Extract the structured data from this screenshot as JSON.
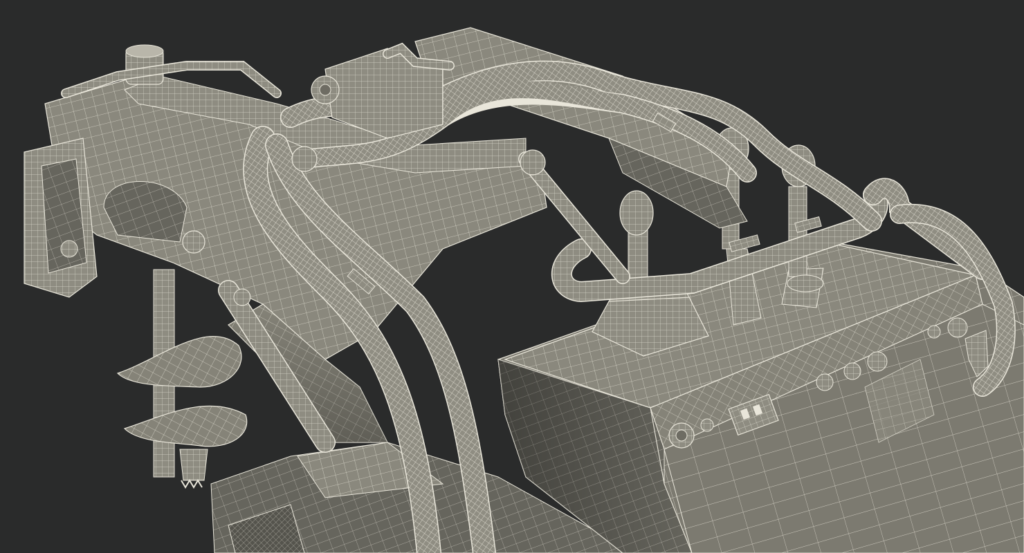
{
  "scene": {
    "subject": "mini-loader-with-auger-wireframe",
    "colors": {
      "background": "#2a2b2b",
      "surface": "#8e8c81",
      "surface_light": "#b9b6aa",
      "surface_dark": "#5c5b53",
      "wire": "#e9e6da",
      "shadow": "#3a3a36"
    }
  }
}
